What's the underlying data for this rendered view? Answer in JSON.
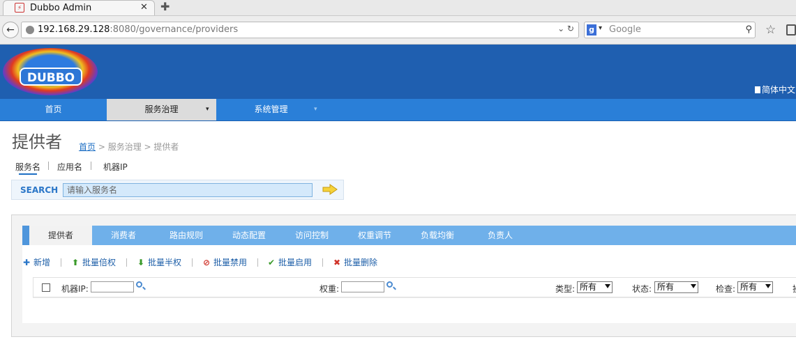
{
  "browser": {
    "tab_title": "Dubbo Admin",
    "tab_close": "✕",
    "new_tab": "✚",
    "url_host": "192.168.29.128",
    "url_rest": ":8080/governance/providers",
    "url_controls": "⌄ ↻",
    "search_engine": "g",
    "search_placeholder": "Google"
  },
  "header": {
    "logo_text": "DUBBO",
    "language": "简体中文"
  },
  "menu": {
    "items": [
      {
        "label": "首页"
      },
      {
        "label": "服务治理",
        "arrow": "▾"
      },
      {
        "label": "系统管理",
        "arrow": "▾"
      }
    ]
  },
  "page": {
    "title": "提供者",
    "breadcrumb": {
      "home": "首页",
      "rest": " > 服务治理 > 提供者"
    },
    "subtabs": [
      "服务名",
      "应用名",
      "机器IP"
    ]
  },
  "search": {
    "label": "SEARCH",
    "placeholder": "请输入服务名"
  },
  "panel_tabs": [
    "提供者",
    "消费者",
    "路由规则",
    "动态配置",
    "访问控制",
    "权重调节",
    "负载均衡",
    "负责人"
  ],
  "toolbar": [
    {
      "icon": "✚",
      "label": "新增",
      "color": "#2a76c8"
    },
    {
      "icon": "⬆",
      "label": "批量倍权",
      "color": "#3a9a2a"
    },
    {
      "icon": "⬇",
      "label": "批量半权",
      "color": "#3a9a2a"
    },
    {
      "icon": "⊘",
      "label": "批量禁用",
      "color": "#d0332a"
    },
    {
      "icon": "✔",
      "label": "批量启用",
      "color": "#3a9a2a"
    },
    {
      "icon": "✖",
      "label": "批量删除",
      "color": "#d0332a"
    }
  ],
  "filters": {
    "ip_label": "机器IP:",
    "weight_label": "权重:",
    "type_label": "类型:",
    "type_value": "所有",
    "status_label": "状态:",
    "status_value": "所有",
    "check_label": "检查:",
    "check_value": "所有",
    "cut_label": "操"
  },
  "colors": {
    "header_bg": "#1f5fb0",
    "menu_bg": "#2a7fd8",
    "panel_tabs_bg": "#6fb0ea",
    "link": "#1e6fc4"
  }
}
